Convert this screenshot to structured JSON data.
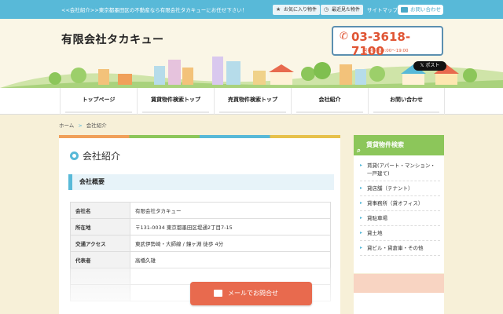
{
  "topbar": {
    "tagline": "<<会社紹介>>東京都墨田区の不動産なら有限会社タカキューにお任せ下さい！",
    "favorites_label": "お気に入り物件",
    "recent_label": "最近見た物件",
    "sitemap_label": "サイトマップ",
    "contact_label": "お問い合わせ"
  },
  "header": {
    "company_name": "有限会社タカキュー",
    "phone": "03-3618-7100",
    "hours": "営業時間/9:00〜19:00",
    "x_post_label": "ポスト"
  },
  "nav": {
    "items": [
      {
        "label": "トップページ"
      },
      {
        "label": "賃貸物件検索トップ"
      },
      {
        "label": "売買物件検索トップ"
      },
      {
        "label": "会社紹介"
      },
      {
        "label": "お問い合わせ"
      }
    ]
  },
  "breadcrumb": {
    "home": "ホーム",
    "separator": ">",
    "current": "会社紹介"
  },
  "main": {
    "title": "会社紹介",
    "section_heading": "会社概要",
    "rows": [
      {
        "key": "会社名",
        "value": "有限会社タカキュー"
      },
      {
        "key": "所在地",
        "value": "〒131-0034 東京都墨田区堤通2丁目7-15"
      },
      {
        "key": "交通アクセス",
        "value": "東武伊勢崎・大師線 / 鐘ヶ淵 徒歩 4分"
      },
      {
        "key": "代表者",
        "value": "高橋久雄"
      }
    ]
  },
  "mail_button": {
    "label": "メールでお問合せ"
  },
  "sidebar": {
    "heading": "賃貸物件検索",
    "items": [
      {
        "label": "賃貸(アパート・マンション・一戸建て)"
      },
      {
        "label": "貸店舗（テナント）"
      },
      {
        "label": "貸事務所（貸オフィス）"
      },
      {
        "label": "貸駐車場"
      },
      {
        "label": "貸土地"
      },
      {
        "label": "貸ビル・貸倉庫・その他"
      }
    ]
  },
  "colors": {
    "accent_blue": "#58b9d8",
    "phone_red": "#e05534",
    "sidebar_green": "#8cc65a",
    "mail_orange": "#e86a4e"
  },
  "icons": {
    "favorites": "star-icon",
    "recent": "clock-icon",
    "contact": "envelope-icon",
    "phone": "phone-icon",
    "search": "search-icon",
    "mail": "envelope-icon"
  }
}
